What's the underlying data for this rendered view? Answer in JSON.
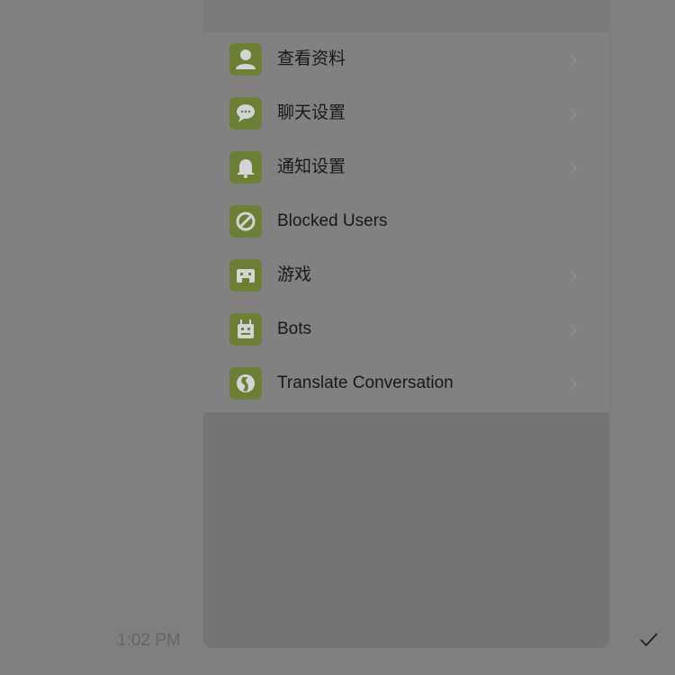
{
  "menu": {
    "items": [
      {
        "label": "查看资料",
        "icon": "profile-icon",
        "has_chevron": true
      },
      {
        "label": "聊天设置",
        "icon": "chat-bubble-icon",
        "has_chevron": true
      },
      {
        "label": "通知设置",
        "icon": "bell-icon",
        "has_chevron": true
      },
      {
        "label": "Blocked Users",
        "icon": "block-icon",
        "has_chevron": false
      },
      {
        "label": "游戏",
        "icon": "game-icon",
        "has_chevron": true
      },
      {
        "label": "Bots",
        "icon": "bot-icon",
        "has_chevron": true
      },
      {
        "label": "Translate Conversation",
        "icon": "translate-icon",
        "has_chevron": true
      }
    ]
  },
  "message": {
    "time": "1:02 PM",
    "status_icon": "checkmark-icon"
  },
  "colors": {
    "icon_bg": "#6b7f35",
    "overlay": "#7f7f7f"
  }
}
